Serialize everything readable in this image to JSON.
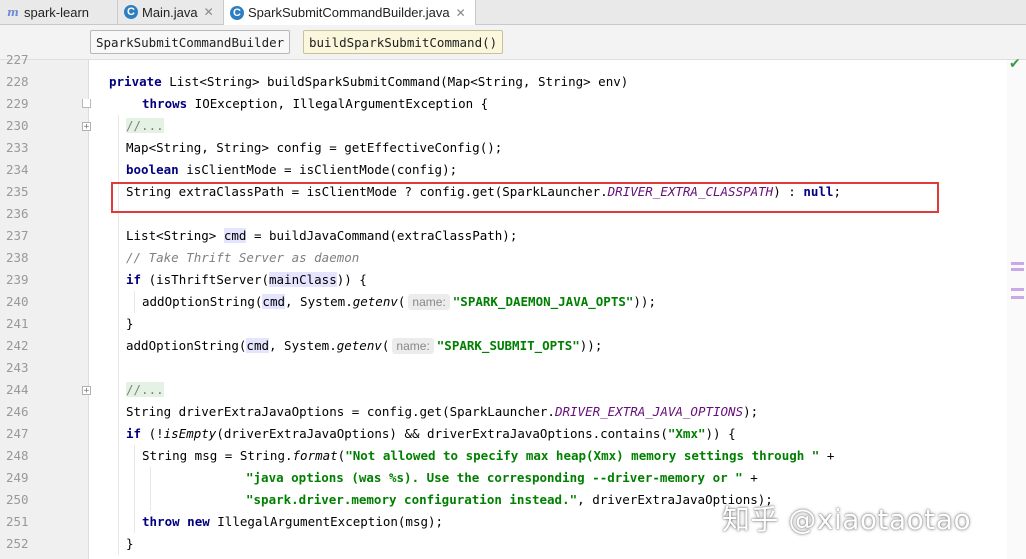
{
  "tabs": [
    {
      "label": "spark-learn",
      "icon": "module-icon"
    },
    {
      "label": "Main.java",
      "icon": "java-class-icon"
    },
    {
      "label": "SparkSubmitCommandBuilder.java",
      "icon": "java-class-icon",
      "active": true
    }
  ],
  "breadcrumb": {
    "class_name": "SparkSubmitCommandBuilder",
    "method_name": "buildSparkSubmitCommand()"
  },
  "line_numbers": [
    "227",
    "228",
    "229",
    "230",
    "233",
    "234",
    "235",
    "236",
    "237",
    "238",
    "239",
    "240",
    "241",
    "242",
    "243",
    "244",
    "246",
    "247",
    "248",
    "249",
    "250",
    "251",
    "252"
  ],
  "code": {
    "l228": {
      "kw": "private",
      "rest": " List<String> buildSparkSubmitCommand(Map<String, String> env)"
    },
    "l229": {
      "kw": "throws",
      "rest": " IOException, IllegalArgumentException {"
    },
    "l230": {
      "fold": "//..."
    },
    "l233": {
      "text": "Map<String, String> config = getEffectiveConfig();"
    },
    "l234": {
      "kw": "boolean",
      "rest": " isClientMode = isClientMode(config);"
    },
    "l235": {
      "pre": "String extraClassPath = isClientMode ? config.get(SparkLauncher.",
      "const": "DRIVER_EXTRA_CLASSPATH",
      "post": ") : ",
      "kw": "null",
      "end": ";"
    },
    "l237": {
      "pre": "List<String> ",
      "var": "cmd",
      "post": " = buildJavaCommand(extraClassPath);"
    },
    "l238": {
      "comment": "// Take Thrift Server as daemon"
    },
    "l239": {
      "kw": "if",
      "pre": " (isThriftServer(",
      "arg": "mainClass",
      "post": ")) {"
    },
    "l240": {
      "pre": "addOptionString(",
      "var": "cmd",
      "mid": ", System.",
      "method": "getenv",
      "paren": "(",
      "hint": "name:",
      "str": "\"SPARK_DAEMON_JAVA_OPTS\"",
      "end": "));"
    },
    "l241": {
      "text": "}"
    },
    "l242": {
      "pre": "addOptionString(",
      "var": "cmd",
      "mid": ", System.",
      "method": "getenv",
      "paren": "(",
      "hint": "name:",
      "str": "\"SPARK_SUBMIT_OPTS\"",
      "end": "));"
    },
    "l244": {
      "fold": "//..."
    },
    "l246": {
      "pre": "String driverExtraJavaOptions = config.get(SparkLauncher.",
      "const": "DRIVER_EXTRA_JAVA_OPTIONS",
      "end": ");"
    },
    "l247": {
      "kw": "if",
      "pre": " (!",
      "method": "isEmpty",
      "mid": "(driverExtraJavaOptions) && driverExtraJavaOptions.contains(",
      "str": "\"Xmx\"",
      "end": ")) {"
    },
    "l248": {
      "pre": "String msg = String.",
      "method": "format",
      "paren": "(",
      "str": "\"Not allowed to specify max heap(Xmx) memory settings through \"",
      "end": " +"
    },
    "l249": {
      "str": "\"java options (was %s). Use the corresponding --driver-memory or \"",
      "end": " +"
    },
    "l250": {
      "str": "\"spark.driver.memory configuration instead.\"",
      "end": ", driverExtraJavaOptions);"
    },
    "l251": {
      "kw": "throw",
      "kw2": "new",
      "rest": " IllegalArgumentException(msg);"
    },
    "l252": {
      "text": "}"
    }
  },
  "watermark": "知乎 @xiaotaotao",
  "colors": {
    "keyword": "#000080",
    "string": "#008000",
    "constant": "#660e7a",
    "comment": "#808080",
    "highlight_box": "#e03a3a"
  }
}
